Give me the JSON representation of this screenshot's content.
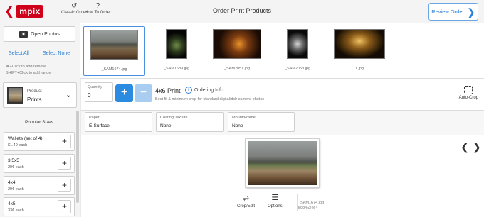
{
  "header": {
    "brand": "mpix",
    "classic_order": "Classic Order",
    "how_to_order": "How To Order",
    "title": "Order Print Products",
    "review_order": "Review Order"
  },
  "photos_panel": {
    "open_photos": "Open Photos",
    "select_all": "Select All",
    "select_none": "Select None",
    "hint1": "⌘+Click to add/remove",
    "hint2": "SHIFT+Click to add range"
  },
  "thumbnails": [
    {
      "name": "_SAM1674.jpg",
      "selected": true
    },
    {
      "name": "_SAM1689.jpg",
      "selected": false
    },
    {
      "name": "_SAM2051.jpg",
      "selected": false
    },
    {
      "name": "_SAM2053.jpg",
      "selected": false
    },
    {
      "name": "1.jpg",
      "selected": false
    }
  ],
  "product": {
    "label": "Product",
    "value": "Prints",
    "popular_sizes": "Popular Sizes",
    "sizes": [
      {
        "name": "Wallets (set of 4)",
        "price": "$1.49 each"
      },
      {
        "name": "3.5x5",
        "price": "29¢ each"
      },
      {
        "name": "4x4",
        "price": "29¢ each"
      },
      {
        "name": "4x5",
        "price": "33¢ each"
      }
    ]
  },
  "options": {
    "quantity_label": "Quantity",
    "quantity": "0",
    "print_title": "4x6 Print",
    "ordering_info": "Ordering Info",
    "description": "Best fit & minimum crop for standard digital/dslr camera photos",
    "auto_crop": "Auto-Crop"
  },
  "attributes": [
    {
      "label": "Paper",
      "value": "E-Surface"
    },
    {
      "label": "Coating/Texture",
      "value": "None"
    },
    {
      "label": "Mount/Frame",
      "value": "None"
    }
  ],
  "preview": {
    "crop_edit": "Crop/Edit",
    "options": "Options",
    "filename": "_SAM1674.jpg",
    "dimensions": "5094x3464"
  },
  "icons": {
    "back": "chevron-left-icon",
    "classic": "history-icon",
    "help": "question-icon",
    "review_arrow": "chevron-right-icon",
    "camera": "camera-icon",
    "dropdown": "chevron-down-icon",
    "plus": "plus-icon",
    "minus": "minus-icon",
    "info": "info-icon",
    "autocrop": "auto-crop-icon",
    "crop": "crop-icon",
    "menu": "menu-icon"
  },
  "colors": {
    "brand": "#d0021b",
    "accent": "#2b8be0",
    "accent_light": "#a8cdf0"
  }
}
